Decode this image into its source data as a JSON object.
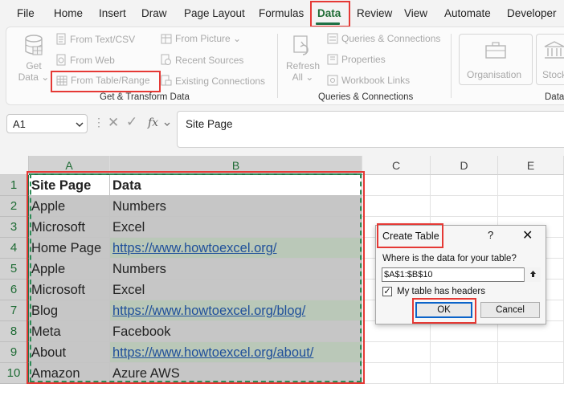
{
  "menu": {
    "tabs": [
      "File",
      "Home",
      "Insert",
      "Draw",
      "Page Layout",
      "Formulas",
      "Data",
      "Review",
      "View",
      "Automate",
      "Developer"
    ],
    "active": "Data"
  },
  "ribbon": {
    "get_data": {
      "line1": "Get",
      "line2": "Data ⌄"
    },
    "from_text_csv": "From Text/CSV",
    "from_web": "From Web",
    "from_table_range": "From Table/Range",
    "from_picture": "From Picture ⌄",
    "recent_sources": "Recent Sources",
    "existing_connections": "Existing Connections",
    "group_get_transform": "Get & Transform Data",
    "refresh_all": {
      "line1": "Refresh",
      "line2": "All ⌄"
    },
    "queries_connections": "Queries & Connections",
    "properties": "Properties",
    "workbook_links": "Workbook Links",
    "group_queries": "Queries & Connections",
    "organisation": "Organisation",
    "stocks": "Stock",
    "group_data_types": "Data"
  },
  "formula_bar": {
    "name_box": "A1",
    "fx": "fx",
    "content": "Site Page"
  },
  "sheet": {
    "columns": [
      "A",
      "B",
      "C",
      "D",
      "E"
    ],
    "rows": [
      "1",
      "2",
      "3",
      "4",
      "5",
      "6",
      "7",
      "8",
      "9",
      "10"
    ],
    "cells": [
      [
        "Site Page",
        "Data"
      ],
      [
        "Apple",
        "Numbers"
      ],
      [
        "Microsoft",
        "Excel"
      ],
      [
        "Home Page",
        "https://www.howtoexcel.org/"
      ],
      [
        "Apple",
        "Numbers"
      ],
      [
        "Microsoft",
        "Excel"
      ],
      [
        "Blog",
        "https://www.howtoexcel.org/blog/"
      ],
      [
        "Meta",
        "Facebook"
      ],
      [
        "About",
        "https://www.howtoexcel.org/about/"
      ],
      [
        "Amazon",
        "Azure AWS"
      ]
    ]
  },
  "dialog": {
    "title": "Create Table",
    "help": "?",
    "close": "✕",
    "question": "Where is the data for your table?",
    "range": "$A$1:$B$10",
    "headers_label": "My table has headers",
    "headers_checked": "✓",
    "ok": "OK",
    "cancel": "Cancel"
  }
}
